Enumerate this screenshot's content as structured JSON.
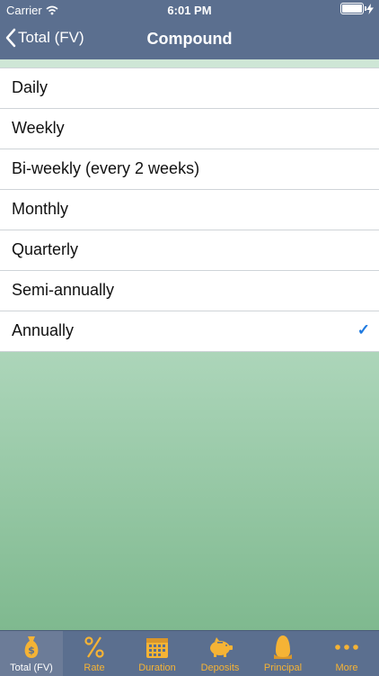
{
  "status_bar": {
    "carrier": "Carrier",
    "time": "6:01 PM"
  },
  "nav": {
    "back_label": "Total (FV)",
    "title": "Compound"
  },
  "options": [
    {
      "label": "Daily",
      "selected": false
    },
    {
      "label": "Weekly",
      "selected": false
    },
    {
      "label": "Bi-weekly (every 2 weeks)",
      "selected": false
    },
    {
      "label": "Monthly",
      "selected": false
    },
    {
      "label": "Quarterly",
      "selected": false
    },
    {
      "label": "Semi-annually",
      "selected": false
    },
    {
      "label": "Annually",
      "selected": true
    }
  ],
  "check_mark": "✓",
  "tabs": [
    {
      "label": "Total (FV)",
      "icon": "money-bag-icon",
      "active": true
    },
    {
      "label": "Rate",
      "icon": "percent-icon",
      "active": false
    },
    {
      "label": "Duration",
      "icon": "calendar-icon",
      "active": false
    },
    {
      "label": "Deposits",
      "icon": "piggy-bank-icon",
      "active": false
    },
    {
      "label": "Principal",
      "icon": "egg-icon",
      "active": false
    },
    {
      "label": "More",
      "icon": "more-icon",
      "active": false
    }
  ],
  "colors": {
    "bar": "#5b6f8f",
    "accent": "#f5b335",
    "check": "#1f7ae0"
  }
}
